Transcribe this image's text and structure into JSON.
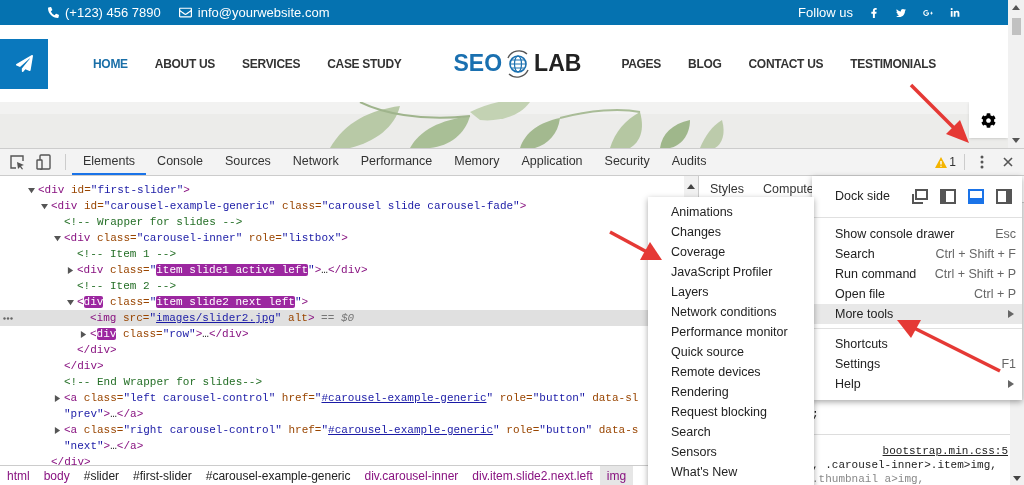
{
  "topbar": {
    "phone": "(+123) 456 7890",
    "email": "info@yourwebsite.com",
    "follow_label": "Follow us",
    "socials": [
      {
        "kind": "facebook"
      },
      {
        "kind": "twitter"
      },
      {
        "kind": "googleplus"
      },
      {
        "kind": "linkedin"
      }
    ]
  },
  "header": {
    "logo": {
      "left": "SEO",
      "right": "LAB"
    },
    "nav_left": [
      {
        "label": "HOME",
        "selected": true
      },
      {
        "label": "ABOUT US",
        "selected": false
      },
      {
        "label": "SERVICES",
        "selected": false
      },
      {
        "label": "CASE STUDY",
        "selected": false
      }
    ],
    "nav_right": [
      {
        "label": "PAGES",
        "selected": false
      },
      {
        "label": "BLOG",
        "selected": false
      },
      {
        "label": "CONTACT US",
        "selected": false
      },
      {
        "label": "TESTIMONIALS",
        "selected": false
      }
    ]
  },
  "devtools": {
    "tabs": [
      {
        "label": "Elements",
        "selected": true
      },
      {
        "label": "Console",
        "selected": false
      },
      {
        "label": "Sources",
        "selected": false
      },
      {
        "label": "Network",
        "selected": false
      },
      {
        "label": "Performance",
        "selected": false
      },
      {
        "label": "Memory",
        "selected": false
      },
      {
        "label": "Application",
        "selected": false
      },
      {
        "label": "Security",
        "selected": false
      },
      {
        "label": "Audits",
        "selected": false
      }
    ],
    "warning_count": "1",
    "dom_tree": [
      {
        "open": [
          {
            "kind": "tag",
            "text": "<div"
          },
          {
            "kind": "attr",
            "text": " id="
          },
          {
            "kind": "val",
            "text": "\"first-slider\""
          },
          {
            "kind": "tag",
            "text": ">"
          }
        ],
        "expanded": true,
        "selected": false,
        "children": [
          {
            "open": [
              {
                "kind": "tag",
                "text": "<div"
              },
              {
                "kind": "attr",
                "text": " id="
              },
              {
                "kind": "val",
                "text": "\"carousel-example-generic\""
              },
              {
                "kind": "attr",
                "text": " class="
              },
              {
                "kind": "val",
                "text": "\"carousel slide carousel-fade\""
              },
              {
                "kind": "tag",
                "text": ">"
              }
            ],
            "expanded": true,
            "selected": false,
            "close": [
              {
                "kind": "tag",
                "text": "</div>"
              }
            ],
            "children": [
              {
                "open": [
                  {
                    "kind": "comment",
                    "text": "<!-- Wrapper for slides -->"
                  }
                ],
                "selected": false
              },
              {
                "open": [
                  {
                    "kind": "tag",
                    "text": "<div"
                  },
                  {
                    "kind": "attr",
                    "text": " class="
                  },
                  {
                    "kind": "val",
                    "text": "\"carousel-inner\""
                  },
                  {
                    "kind": "attr",
                    "text": " role="
                  },
                  {
                    "kind": "val",
                    "text": "\"listbox\""
                  },
                  {
                    "kind": "tag",
                    "text": ">"
                  }
                ],
                "expanded": true,
                "selected": false,
                "close": [
                  {
                    "kind": "tag",
                    "text": "</div>"
                  }
                ],
                "children": [
                  {
                    "open": [
                      {
                        "kind": "comment",
                        "text": "<!-- Item 1 -->"
                      }
                    ],
                    "selected": false
                  },
                  {
                    "open": [
                      {
                        "kind": "tag",
                        "text": "<div"
                      },
                      {
                        "kind": "attr",
                        "text": " class="
                      },
                      {
                        "kind": "val",
                        "text": "\""
                      },
                      {
                        "kind": "hl",
                        "text": "item slide1 active left"
                      },
                      {
                        "kind": "val",
                        "text": "\""
                      },
                      {
                        "kind": "tag",
                        "text": ">"
                      },
                      {
                        "kind": "plain",
                        "text": "…"
                      },
                      {
                        "kind": "tag",
                        "text": "</div>"
                      }
                    ],
                    "expanded": false,
                    "selected": false
                  },
                  {
                    "open": [
                      {
                        "kind": "comment",
                        "text": "<!-- Item 2 -->"
                      }
                    ],
                    "selected": false
                  },
                  {
                    "open": [
                      {
                        "kind": "tag",
                        "text": "<"
                      },
                      {
                        "kind": "hl",
                        "text": "div"
                      },
                      {
                        "kind": "attr",
                        "text": " class="
                      },
                      {
                        "kind": "val",
                        "text": "\""
                      },
                      {
                        "kind": "hl",
                        "text": "item slide2 next left"
                      },
                      {
                        "kind": "val",
                        "text": "\""
                      },
                      {
                        "kind": "tag",
                        "text": ">"
                      }
                    ],
                    "expanded": true,
                    "selected": false,
                    "close": [
                      {
                        "kind": "tag",
                        "text": "</div>"
                      }
                    ],
                    "children": [
                      {
                        "open": [
                          {
                            "kind": "tag",
                            "text": "<img"
                          },
                          {
                            "kind": "attr",
                            "text": " src="
                          },
                          {
                            "kind": "val",
                            "text": "\""
                          },
                          {
                            "kind": "link",
                            "text": "images/slider2.jpg"
                          },
                          {
                            "kind": "val",
                            "text": "\""
                          },
                          {
                            "kind": "attr",
                            "text": " alt"
                          },
                          {
                            "kind": "tag",
                            "text": ">"
                          },
                          {
                            "kind": "dim",
                            "text": " == $0"
                          }
                        ],
                        "selected": true
                      },
                      {
                        "open": [
                          {
                            "kind": "tag",
                            "text": "<"
                          },
                          {
                            "kind": "hl",
                            "text": "div"
                          },
                          {
                            "kind": "attr",
                            "text": " class="
                          },
                          {
                            "kind": "val",
                            "text": "\"row\""
                          },
                          {
                            "kind": "tag",
                            "text": ">"
                          },
                          {
                            "kind": "plain",
                            "text": "…"
                          },
                          {
                            "kind": "tag",
                            "text": "</div>"
                          }
                        ],
                        "expanded": false,
                        "selected": false
                      }
                    ]
                  }
                ]
              },
              {
                "open": [
                  {
                    "kind": "comment",
                    "text": "<!-- End Wrapper for slides-->"
                  }
                ],
                "selected": false
              },
              {
                "open": [
                  {
                    "kind": "tag",
                    "text": "<a"
                  },
                  {
                    "kind": "attr",
                    "text": " class="
                  },
                  {
                    "kind": "val",
                    "text": "\"left carousel-control\""
                  },
                  {
                    "kind": "attr",
                    "text": " href="
                  },
                  {
                    "kind": "val",
                    "text": "\""
                  },
                  {
                    "kind": "link",
                    "text": "#carousel-example-generic"
                  },
                  {
                    "kind": "val",
                    "text": "\""
                  },
                  {
                    "kind": "attr",
                    "text": " role="
                  },
                  {
                    "kind": "val",
                    "text": "\"button\""
                  },
                  {
                    "kind": "attr",
                    "text": " data-sl"
                  }
                ],
                "wrap": [
                  {
                    "kind": "val",
                    "text": "\"prev\""
                  },
                  {
                    "kind": "tag",
                    "text": ">"
                  },
                  {
                    "kind": "plain",
                    "text": "…"
                  },
                  {
                    "kind": "tag",
                    "text": "</a>"
                  }
                ],
                "expanded": false,
                "selected": false
              },
              {
                "open": [
                  {
                    "kind": "tag",
                    "text": "<a"
                  },
                  {
                    "kind": "attr",
                    "text": " class="
                  },
                  {
                    "kind": "val",
                    "text": "\"right carousel-control\""
                  },
                  {
                    "kind": "attr",
                    "text": " href="
                  },
                  {
                    "kind": "val",
                    "text": "\""
                  },
                  {
                    "kind": "link",
                    "text": "#carousel-example-generic"
                  },
                  {
                    "kind": "val",
                    "text": "\""
                  },
                  {
                    "kind": "attr",
                    "text": " role="
                  },
                  {
                    "kind": "val",
                    "text": "\"button\""
                  },
                  {
                    "kind": "attr",
                    "text": " data-s"
                  }
                ],
                "wrap": [
                  {
                    "kind": "val",
                    "text": "\"next\""
                  },
                  {
                    "kind": "tag",
                    "text": ">"
                  },
                  {
                    "kind": "plain",
                    "text": "…"
                  },
                  {
                    "kind": "tag",
                    "text": "</a>"
                  }
                ],
                "expanded": false,
                "selected": false
              }
            ]
          }
        ]
      }
    ],
    "breadcrumbs": [
      {
        "text": "html",
        "kind": "tag",
        "selected": false
      },
      {
        "text": "body",
        "kind": "tag",
        "selected": false
      },
      {
        "text": "#slider",
        "kind": "id",
        "selected": false
      },
      {
        "text": "#first-slider",
        "kind": "id",
        "selected": false
      },
      {
        "text": "#carousel-example-generic",
        "kind": "id",
        "selected": false
      },
      {
        "text": "div.carousel-inner",
        "kind": "tag",
        "selected": false
      },
      {
        "text": "div.item.slide2.next.left",
        "kind": "tag",
        "selected": false
      },
      {
        "text": "img",
        "kind": "tag",
        "selected": true
      }
    ],
    "styles_pane": {
      "tabs": [
        "Styles",
        "Compute"
      ],
      "rule_end": ";",
      "source_link": "bootstrap.min.css:5",
      "selectors": [
        {
          "text": ", .carousel-inner>.item>img,",
          "dim": false
        },
        {
          "text": ".thumbnail a>img,",
          "dim": true
        }
      ]
    },
    "main_menu": {
      "dock_label": "Dock side",
      "dock_options": [
        {
          "kind": "undock",
          "selected": false
        },
        {
          "kind": "left",
          "selected": false
        },
        {
          "kind": "bottom",
          "selected": true
        },
        {
          "kind": "right",
          "selected": false
        }
      ],
      "groups": [
        [
          {
            "label": "Show console drawer",
            "shortcut": "Esc",
            "submenu": false,
            "selected": false
          },
          {
            "label": "Search",
            "shortcut": "Ctrl + Shift + F",
            "submenu": false,
            "selected": false
          },
          {
            "label": "Run command",
            "shortcut": "Ctrl + Shift + P",
            "submenu": false,
            "selected": false
          },
          {
            "label": "Open file",
            "shortcut": "Ctrl + P",
            "submenu": false,
            "selected": false
          },
          {
            "label": "More tools",
            "submenu": true,
            "selected": true
          }
        ],
        [
          {
            "label": "Shortcuts",
            "submenu": false,
            "selected": false
          },
          {
            "label": "Settings",
            "shortcut": "F1",
            "submenu": false,
            "selected": false
          },
          {
            "label": "Help",
            "submenu": true,
            "selected": false
          }
        ]
      ]
    },
    "more_tools_menu": {
      "items": [
        "Animations",
        "Changes",
        "Coverage",
        "JavaScript Profiler",
        "Layers",
        "Network conditions",
        "Performance monitor",
        "Quick source",
        "Remote devices",
        "Rendering",
        "Request blocking",
        "Search",
        "Sensors",
        "What's New"
      ]
    }
  }
}
